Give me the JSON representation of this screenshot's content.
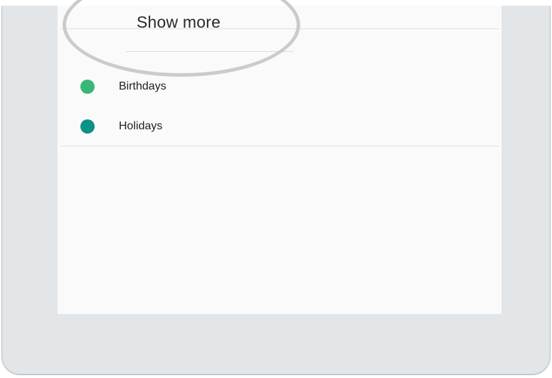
{
  "drawer": {
    "show_more_label": "Show more",
    "calendars": [
      {
        "label": "Birthdays",
        "color": "#3ab777"
      },
      {
        "label": "Holidays",
        "color": "#0b9185"
      }
    ]
  }
}
